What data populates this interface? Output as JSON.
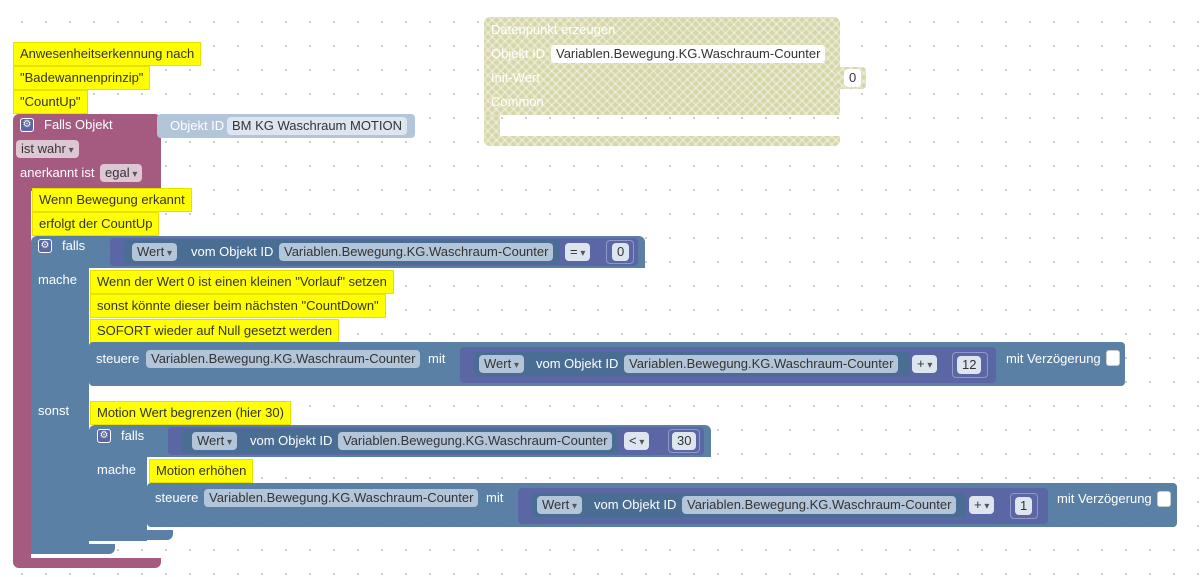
{
  "colors": {
    "purple_block": "#a55b80",
    "blue_block": "#5b80a5",
    "navy_block": "#5b67a5",
    "khaki_block": "#d6d6a8",
    "comment_bg": "#ffff00"
  },
  "datapoint_block": {
    "title": "Datenpunkt erzeugen",
    "object_id_label": "Objekt ID",
    "object_id_value": "Variablen.Bewegung.KG.Waschraum-Counter",
    "init_label": "Init-Wert",
    "init_value": "0",
    "common_label": "Common"
  },
  "header_comments": [
    "Anwesenheitserkennung nach",
    "\"Badewannenprinzip\"",
    "\"CountUp\""
  ],
  "trigger_block": {
    "title": "Falls Objekt",
    "object_id_label": "Objekt ID",
    "object_id_value": "BM KG Waschraum MOTION",
    "condition_value": "ist wahr",
    "ack_label": "anerkannt ist",
    "ack_value": "egal"
  },
  "trigger_comments": [
    "Wenn Bewegung erkannt",
    "erfolgt der CountUp"
  ],
  "if_block": {
    "falls_label": "falls",
    "mache_label": "mache",
    "sonst_label": "sonst",
    "condition": {
      "attr": "Wert",
      "of_label": "vom Objekt ID",
      "object_id": "Variablen.Bewegung.KG.Waschraum-Counter",
      "operator": "=",
      "value": "0"
    },
    "mache_comments": [
      "Wenn der Wert 0 ist einen kleinen \"Vorlauf\" setzen",
      "sonst könnte dieser beim nächsten \"CountDown\"",
      "SOFORT wieder auf Null gesetzt werden"
    ],
    "set_block": {
      "label": "steuere",
      "target": "Variablen.Bewegung.KG.Waschraum-Counter",
      "with_label": "mit",
      "attr": "Wert",
      "of_label": "vom Objekt ID",
      "source": "Variablen.Bewegung.KG.Waschraum-Counter",
      "operator": "+",
      "value": "12",
      "delay_label": "mit Verzögerung"
    },
    "sonst_comment": "Motion Wert begrenzen (hier 30)"
  },
  "inner_if_block": {
    "falls_label": "falls",
    "mache_label": "mache",
    "condition": {
      "attr": "Wert",
      "of_label": "vom Objekt ID",
      "object_id": "Variablen.Bewegung.KG.Waschraum-Counter",
      "operator": "<",
      "value": "30"
    },
    "mache_comment": "Motion erhöhen",
    "set_block": {
      "label": "steuere",
      "target": "Variablen.Bewegung.KG.Waschraum-Counter",
      "with_label": "mit",
      "attr": "Wert",
      "of_label": "vom Objekt ID",
      "source": "Variablen.Bewegung.KG.Waschraum-Counter",
      "operator": "+",
      "value": "1",
      "delay_label": "mit Verzögerung"
    }
  }
}
